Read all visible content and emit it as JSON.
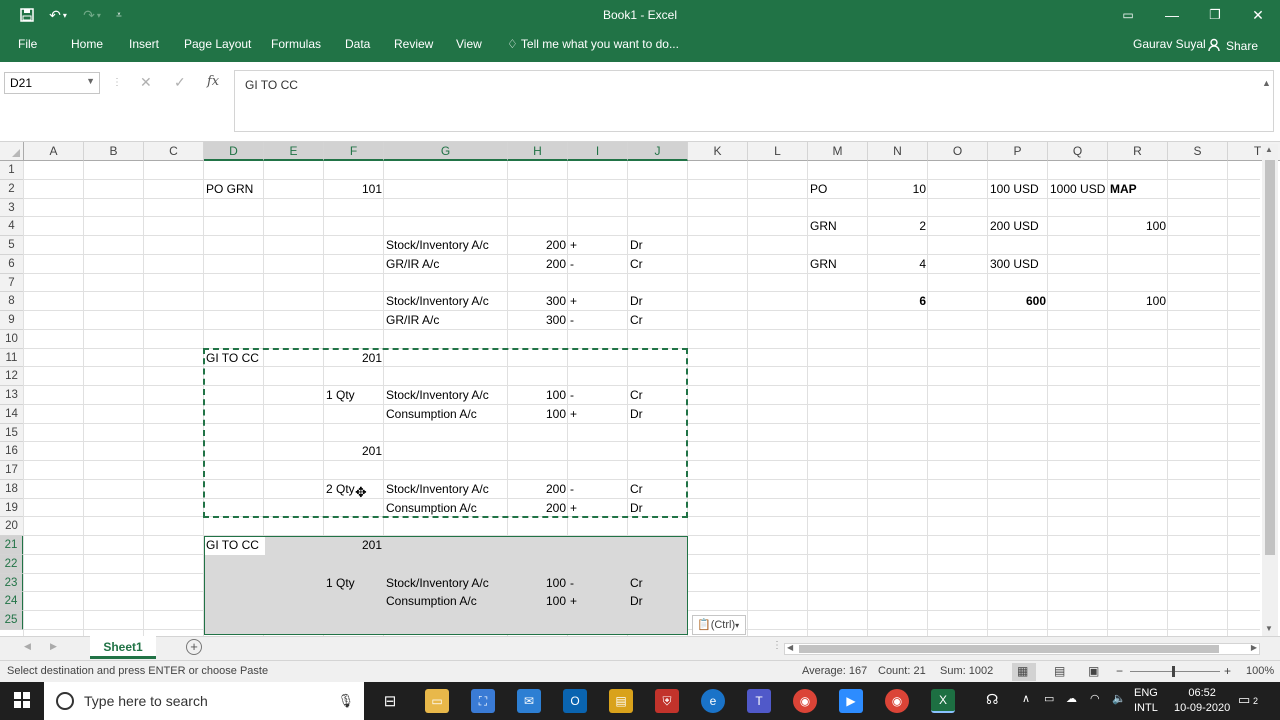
{
  "window": {
    "title": "Book1 - Excel",
    "user": "Gaurav Suyal",
    "share_label": "Share"
  },
  "ribbon": {
    "tabs": [
      "File",
      "Home",
      "Insert",
      "Page Layout",
      "Formulas",
      "Data",
      "Review",
      "View"
    ],
    "tell_me": "Tell me what you want to do..."
  },
  "formula_bar": {
    "name_box": "D21",
    "formula": "GI TO CC"
  },
  "columns": [
    "A",
    "B",
    "C",
    "D",
    "E",
    "F",
    "G",
    "H",
    "I",
    "J",
    "K",
    "L",
    "M",
    "N",
    "O",
    "P",
    "Q",
    "R",
    "S",
    "T"
  ],
  "rows": [
    "1",
    "2",
    "3",
    "4",
    "5",
    "6",
    "7",
    "8",
    "9",
    "10",
    "11",
    "12",
    "13",
    "14",
    "15",
    "16",
    "17",
    "18",
    "19",
    "20",
    "21",
    "22",
    "23",
    "24",
    "25"
  ],
  "cells": {
    "D2": "PO GRN",
    "F2": "101",
    "M2": "PO",
    "N2": "10",
    "P2": "100 USD",
    "Q2": "1000 USD",
    "R2": "MAP",
    "M4": "GRN",
    "N4": "2",
    "P4": "200 USD",
    "R4": "100",
    "G5": "Stock/Inventory A/c",
    "H5": "200",
    "I5": "+",
    "J5": "Dr",
    "G6": "GR/IR A/c",
    "H6": "200",
    "I6": "-",
    "J6": "Cr",
    "M6": "GRN",
    "N6": "4",
    "P6": "300 USD",
    "G8": "Stock/Inventory A/c",
    "H8": "300",
    "I8": "+",
    "J8": "Dr",
    "N8": "6",
    "P8": "600",
    "R8": "100",
    "G9": "GR/IR A/c",
    "H9": "300",
    "I9": "-",
    "J9": "Cr",
    "D11": "GI TO CC",
    "F11": "201",
    "F13": "1 Qty",
    "G13": "Stock/Inventory A/c",
    "H13": "100",
    "I13": "-",
    "J13": "Cr",
    "G14": "Consumption A/c",
    "H14": "100",
    "I14": "+",
    "J14": "Dr",
    "F16": "201",
    "F18": "2 Qty",
    "G18": "Stock/Inventory A/c",
    "H18": "200",
    "I18": "-",
    "J18": "Cr",
    "G19": "Consumption A/c",
    "H19": "200",
    "I19": "+",
    "J19": "Dr",
    "D21": "GI TO CC",
    "F21": "201",
    "F23": "1 Qty",
    "G23": "Stock/Inventory A/c",
    "H23": "100",
    "I23": "-",
    "J23": "Cr",
    "G24": "Consumption A/c",
    "H24": "100",
    "I24": "+",
    "J24": "Dr"
  },
  "paste_options": "(Ctrl)",
  "sheets": [
    "Sheet1"
  ],
  "status": {
    "message": "Select destination and press ENTER or choose Paste",
    "average": "Average: 167",
    "count": "Count: 21",
    "sum": "Sum: 1002",
    "zoom": "100%"
  },
  "taskbar": {
    "search_placeholder": "Type here to search",
    "lang1": "ENG",
    "lang2": "INTL",
    "time": "06:52",
    "date": "10-09-2020",
    "notif": "2"
  },
  "colors": {
    "excel_green": "#217346",
    "selection_fill": "#d9d9d9"
  }
}
